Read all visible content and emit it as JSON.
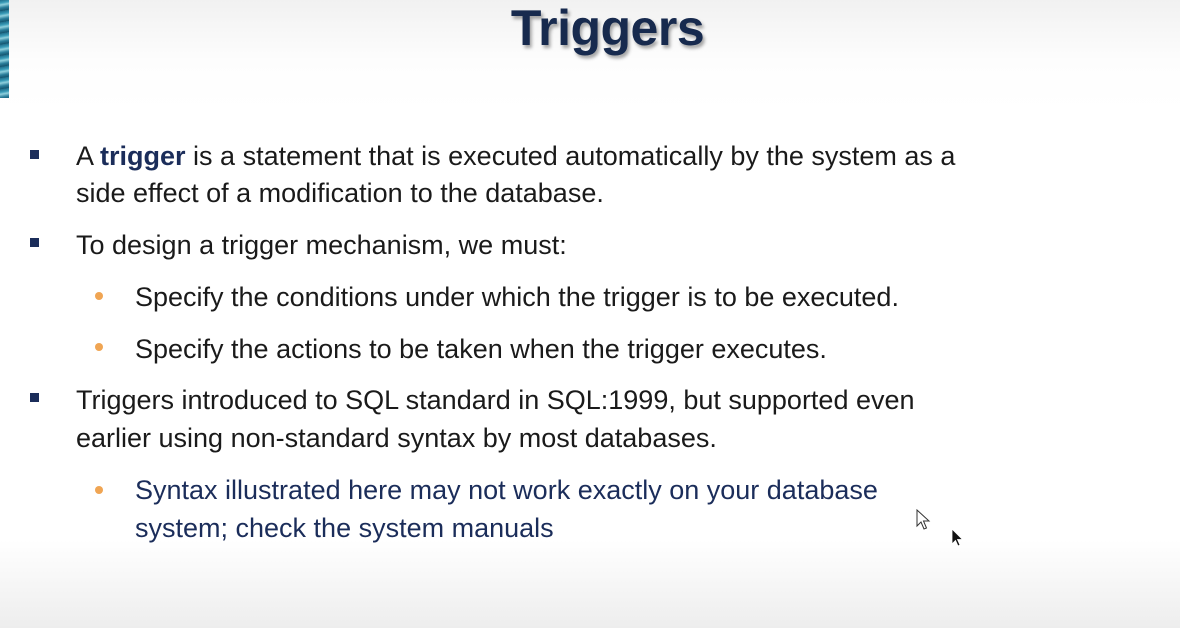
{
  "slide": {
    "title": "Triggers",
    "bullets": [
      {
        "prefix": "A ",
        "term": "trigger",
        "line1_rest": " is a statement that is executed automatically by the system as a",
        "line2": "side effect of a modification to the database."
      },
      {
        "line1": "To design a trigger mechanism, we must:",
        "sub": [
          "Specify the conditions under which the trigger is to be executed.",
          "Specify the actions to be taken when the trigger executes."
        ]
      },
      {
        "line1": "Triggers introduced to SQL standard in SQL:1999, but supported even",
        "line2": "earlier using non-standard syntax by most databases.",
        "sub": [
          {
            "line1": "Syntax illustrated here may not work exactly on your database",
            "line2": "system; check the system manuals"
          }
        ]
      }
    ]
  },
  "colors": {
    "title": "#172a4e",
    "bullet_square": "#1b2d5a",
    "bullet_dot": "#f0a553",
    "term": "#1b2d5a",
    "note": "#1b2d5a"
  },
  "icons": {
    "cursor_outline": "pointer-outline-icon",
    "cursor_filled": "pointer-filled-icon"
  }
}
